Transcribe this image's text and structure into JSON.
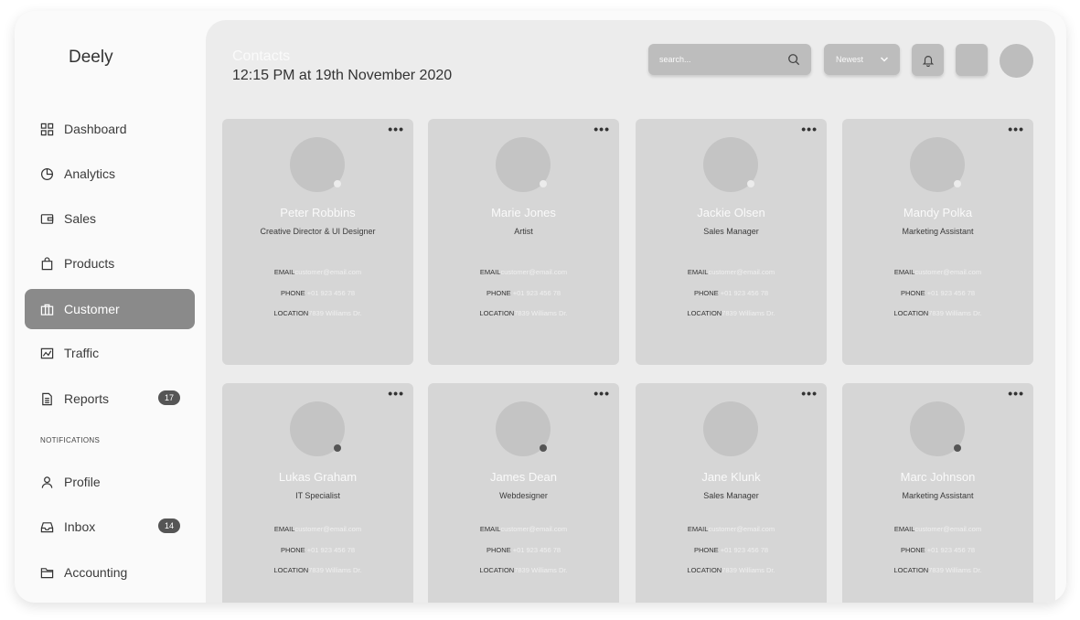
{
  "brand": "Deely",
  "sidebar": {
    "items": [
      {
        "label": "Dashboard",
        "icon": "grid-icon"
      },
      {
        "label": "Analytics",
        "icon": "pie-chart-icon"
      },
      {
        "label": "Sales",
        "icon": "wallet-icon"
      },
      {
        "label": "Products",
        "icon": "bag-icon"
      },
      {
        "label": "Customer",
        "icon": "briefcase-icon",
        "active": true
      },
      {
        "label": "Traffic",
        "icon": "traffic-icon"
      },
      {
        "label": "Reports",
        "icon": "document-icon",
        "badge": "17"
      }
    ],
    "section_label": "NOTIFICATIONS",
    "notification_items": [
      {
        "label": "Profile",
        "icon": "user-icon"
      },
      {
        "label": "Inbox",
        "icon": "inbox-icon",
        "badge": "14"
      },
      {
        "label": "Accounting",
        "icon": "folder-icon"
      }
    ]
  },
  "header": {
    "title": "Contacts",
    "subtitle": "12:15 PM at 19th November 2020",
    "search_placeholder": "search...",
    "sort_value": "Newest"
  },
  "labels": {
    "email": "EMAIL",
    "phone": "PHONE",
    "location": "LOCATION"
  },
  "contacts": [
    {
      "name": "Peter Robbins",
      "role": "Creative Director & UI Designer",
      "email": "customer@email.com",
      "phone": "+01 923 456 78",
      "location": "7839 Williams Dr.",
      "status": "online"
    },
    {
      "name": "Marie Jones",
      "role": "Artist",
      "email": "customer@email.com",
      "phone": "+01 923 456 78",
      "location": "7839 Williams Dr.",
      "status": "online"
    },
    {
      "name": "Jackie Olsen",
      "role": "Sales Manager",
      "email": "customer@email.com",
      "phone": "+01 923 456 78",
      "location": "7839 Williams Dr.",
      "status": "online"
    },
    {
      "name": "Mandy Polka",
      "role": "Marketing Assistant",
      "email": "customer@email.com",
      "phone": "+01 923 456 78",
      "location": "7839 Williams Dr.",
      "status": "online"
    },
    {
      "name": "Lukas Graham",
      "role": "IT Specialist",
      "email": "customer@email.com",
      "phone": "+01 923 456 78",
      "location": "7839 Williams Dr.",
      "status": "away"
    },
    {
      "name": "James Dean",
      "role": "Webdesigner",
      "email": "customer@email.com",
      "phone": "+01 923 456 78",
      "location": "7839 Williams Dr.",
      "status": "away"
    },
    {
      "name": "Jane Klunk",
      "role": "Sales Manager",
      "email": "customer@email.com",
      "phone": "+01 923 456 78",
      "location": "7839 Williams Dr.",
      "status": "none"
    },
    {
      "name": "Marc Johnson",
      "role": "Marketing Assistant",
      "email": "customer@email.com",
      "phone": "+01 923 456 78",
      "location": "7839 Williams Dr.",
      "status": "away"
    }
  ]
}
